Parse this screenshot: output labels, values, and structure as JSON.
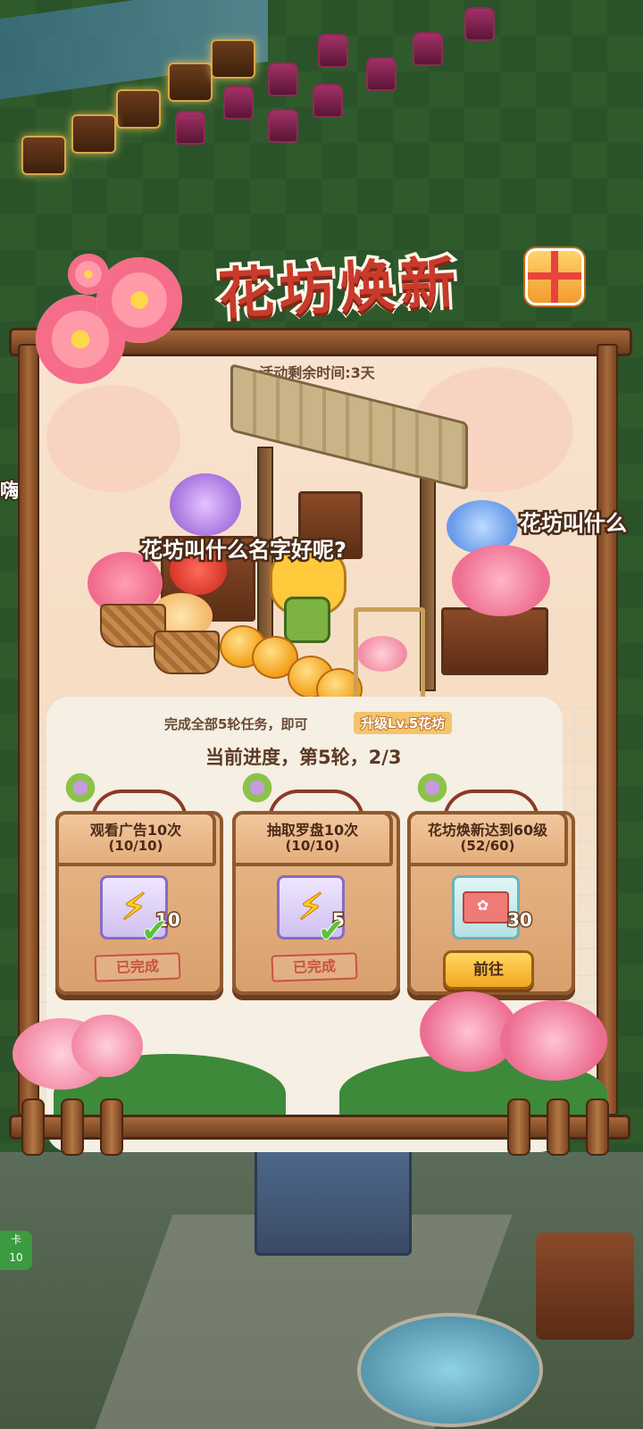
{
  "event": {
    "title": "花坊焕新",
    "remaining_time": "活动剩余时间:3天",
    "speech_main": "花坊叫什么名字好呢?",
    "speech_side": "花坊叫什么",
    "side_left_text": "嗨嗨~"
  },
  "info": {
    "complete_text": "完成全部5轮任务，即可",
    "upgrade_text": "升级Lv.5花坊",
    "progress_text": "当前进度，第5轮，2/3"
  },
  "tasks": [
    {
      "title": "观看广告10次",
      "progress": "(10/10)",
      "reward_icon": "energy-bolt-icon",
      "reward_count": "10",
      "status": "已完成"
    },
    {
      "title": "抽取罗盘10次",
      "progress": "(10/10)",
      "reward_icon": "energy-bolt-icon",
      "reward_count": "5",
      "status": "已完成"
    },
    {
      "title": "花坊焕新达到60级",
      "progress": "(52/60)",
      "reward_icon": "flower-ticket-icon",
      "reward_count": "30",
      "button": "前往"
    }
  ],
  "background": {
    "card_label": "卡",
    "card_count": "10"
  },
  "colors": {
    "title_red": "#c93a2a",
    "wood": "#8f5a30",
    "go_button": "#f3a621",
    "check_green": "#5bc23a"
  }
}
